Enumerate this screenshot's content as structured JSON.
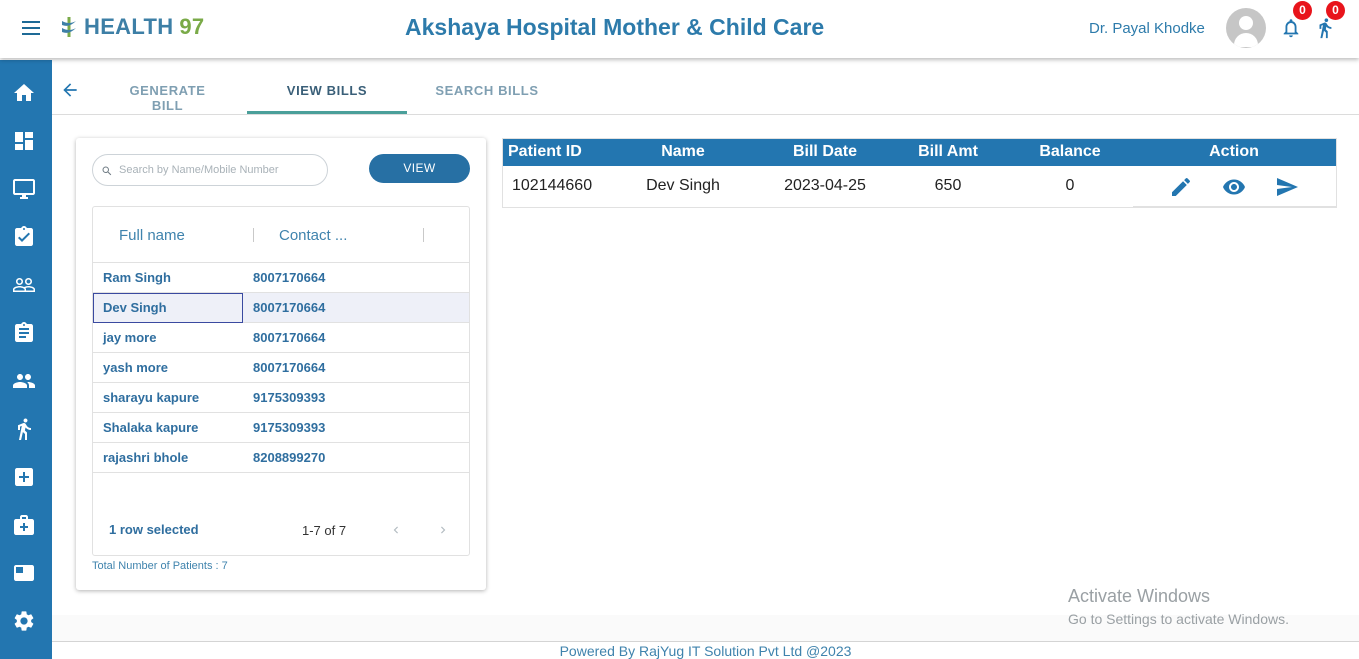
{
  "header": {
    "brand": "HEALTH",
    "brand_num": "97",
    "hospital_title": "Akshaya Hospital Mother & Child Care",
    "doctor_name": "Dr. Payal Khodke",
    "notification_count": "0",
    "walkin_count": "0"
  },
  "tabs": [
    {
      "label": "GENERATE BILL"
    },
    {
      "label": "VIEW BILLS"
    },
    {
      "label": "SEARCH BILLS"
    }
  ],
  "search": {
    "placeholder": "Search by Name/Mobile Number",
    "value": "",
    "view_button": "VIEW"
  },
  "patients": {
    "columns": [
      "Full name",
      "Contact ..."
    ],
    "rows": [
      {
        "name": "Ram Singh",
        "contact": "8007170664"
      },
      {
        "name": "Dev Singh",
        "contact": "8007170664"
      },
      {
        "name": "jay more",
        "contact": "8007170664"
      },
      {
        "name": "yash more",
        "contact": "8007170664"
      },
      {
        "name": "sharayu kapure",
        "contact": "9175309393"
      },
      {
        "name": "Shalaka kapure",
        "contact": "9175309393"
      },
      {
        "name": "rajashri bhole",
        "contact": "8208899270"
      }
    ],
    "selected_text": "1 row selected",
    "range_text": "1-7 of 7",
    "total_text": "Total Number of Patients : 7"
  },
  "bills": {
    "columns": [
      "Patient ID",
      "Name",
      "Bill Date",
      "Bill Amt",
      "Balance",
      "Action"
    ],
    "rows": [
      {
        "patient_id": "102144660",
        "name": "Dev Singh",
        "bill_date": "2023-04-25",
        "bill_amt": "650",
        "balance": "0"
      }
    ]
  },
  "watermark": {
    "line1": "Activate Windows",
    "line2": "Go to Settings to activate Windows."
  },
  "footer": "Powered By RajYug IT Solution Pvt Ltd @2023",
  "colors": {
    "primary": "#2376b0",
    "accent_green": "#7aaa48",
    "badge_red": "#e8141b",
    "tab_underline": "#4a9f9a"
  },
  "sidebar_icons": [
    "home-icon",
    "dashboard-icon",
    "monitor-icon",
    "assignment-check-icon",
    "people-outline-icon",
    "clipboard-icon",
    "people-icon",
    "walking-person-icon",
    "medical-plus-icon",
    "medical-bag-icon",
    "card-icon",
    "gear-icon"
  ]
}
